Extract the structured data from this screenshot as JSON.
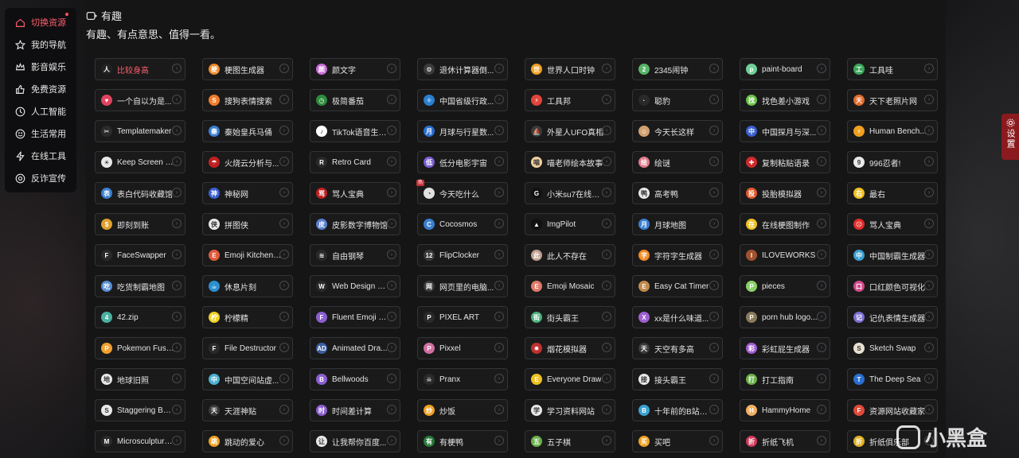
{
  "sidebar": {
    "items": [
      {
        "label": "切换资源",
        "icon": "home-icon",
        "active": true
      },
      {
        "label": "我的导航",
        "icon": "star-icon"
      },
      {
        "label": "影音娱乐",
        "icon": "crown-icon"
      },
      {
        "label": "免费资源",
        "icon": "thumbs-up-icon"
      },
      {
        "label": "人工智能",
        "icon": "clock-icon"
      },
      {
        "label": "生活常用",
        "icon": "smile-icon"
      },
      {
        "label": "在线工具",
        "icon": "bolt-icon"
      },
      {
        "label": "反诈宣传",
        "icon": "target-icon"
      }
    ]
  },
  "section": {
    "title": "有趣",
    "subtitle": "有趣、有点意思、值得一看。"
  },
  "settings": {
    "label": "设置"
  },
  "watermark": {
    "text": "小黑盒"
  },
  "cards": [
    {
      "name": "比较身高",
      "color": "#222",
      "glyph": "人",
      "hot": true
    },
    {
      "name": "梗图生成器",
      "color": "#f08a24",
      "glyph": "梗"
    },
    {
      "name": "颜文字",
      "color": "#c86dd7",
      "glyph": "颜"
    },
    {
      "name": "退休计算器倒...",
      "color": "#3b3b3b",
      "glyph": "⚙"
    },
    {
      "name": "世界人口时钟",
      "color": "#f0a020",
      "glyph": "世"
    },
    {
      "name": "2345闹钟",
      "color": "#58b368",
      "glyph": "2"
    },
    {
      "name": "paint-board",
      "color": "#6fcf97",
      "glyph": "p"
    },
    {
      "name": "工具哇",
      "color": "#3aa65a",
      "glyph": "工"
    },
    {
      "name": "一个自以为是...",
      "color": "#e0445e",
      "glyph": "♥"
    },
    {
      "name": "搜狗表情搜索",
      "color": "#f27b2a",
      "glyph": "S"
    },
    {
      "name": "极简番茄",
      "color": "#2e8b3e",
      "glyph": "◷"
    },
    {
      "name": "中国省级行政...",
      "color": "#2a7fd0",
      "glyph": "⚛"
    },
    {
      "name": "工具邦",
      "color": "#e0443a",
      "glyph": "⚡"
    },
    {
      "name": "聪豹",
      "color": "#2a2a2a",
      "glyph": "·"
    },
    {
      "name": "找色差小游戏",
      "color": "#6cc04a",
      "glyph": "找"
    },
    {
      "name": "天下老照片网",
      "color": "#e06a2a",
      "glyph": "天"
    },
    {
      "name": "Templatemaker",
      "color": "#2b2b2b",
      "glyph": "✂"
    },
    {
      "name": "秦始皇兵马俑",
      "color": "#3a7fd0",
      "glyph": "秦"
    },
    {
      "name": "TikTok语音生成...",
      "color": "#ffffff",
      "glyph": "♪"
    },
    {
      "name": "月球与行星数...",
      "color": "#2a6fd0",
      "glyph": "月"
    },
    {
      "name": "外星人UFO真相",
      "color": "#3a3a3a",
      "glyph": "⛵"
    },
    {
      "name": "今天长这样",
      "color": "#d0a070",
      "glyph": "☺"
    },
    {
      "name": "中国探月与深...",
      "color": "#3a5fd0",
      "glyph": "中"
    },
    {
      "name": "Human Bench...",
      "color": "#f0a020",
      "glyph": "⚡"
    },
    {
      "name": "Keep Screen On",
      "color": "#e8e8e8",
      "glyph": "☀"
    },
    {
      "name": "火烧云分析与...",
      "color": "#c02020",
      "glyph": "☂"
    },
    {
      "name": "Retro Card",
      "color": "#2a2a2a",
      "glyph": "R"
    },
    {
      "name": "低分电影宇宙",
      "color": "#7a5fd0",
      "glyph": "低"
    },
    {
      "name": "喵老师绘本故事",
      "color": "#f0d0a0",
      "glyph": "喵"
    },
    {
      "name": "绘谜",
      "color": "#e07a8a",
      "glyph": "绘"
    },
    {
      "name": "复制粘贴语录",
      "color": "#d02a2a",
      "glyph": "✚"
    },
    {
      "name": "996忍者!",
      "color": "#e8e8e8",
      "glyph": "9"
    },
    {
      "name": "表白代码收藏馆",
      "color": "#3a7fd0",
      "glyph": "表"
    },
    {
      "name": "神秘网",
      "color": "#3a5fd0",
      "glyph": "神"
    },
    {
      "name": "骂人宝典",
      "color": "#c02020",
      "glyph": "骂"
    },
    {
      "name": "今天吃什么",
      "color": "#e0e0e0",
      "glyph": "◔",
      "tag": "热"
    },
    {
      "name": "小米su7在线体...",
      "color": "#111",
      "glyph": "G"
    },
    {
      "name": "高考鸭",
      "color": "#e8e8e8",
      "glyph": "鸭"
    },
    {
      "name": "投胎模拟器",
      "color": "#e05a2a",
      "glyph": "投"
    },
    {
      "name": "最右",
      "color": "#f0c020",
      "glyph": "右"
    },
    {
      "name": "即刻到账",
      "color": "#e0a030",
      "glyph": "$"
    },
    {
      "name": "拼图侠",
      "color": "#e8e8e8",
      "glyph": "侠"
    },
    {
      "name": "皮影数字博物馆",
      "color": "#5a7fd0",
      "glyph": "皮"
    },
    {
      "name": "Cocosmos",
      "color": "#3a7fd0",
      "glyph": "C"
    },
    {
      "name": "ImgPilot",
      "color": "#111",
      "glyph": "▲"
    },
    {
      "name": "月球地图",
      "color": "#3a7fd0",
      "glyph": "月"
    },
    {
      "name": "在线梗图制作",
      "color": "#f0c020",
      "glyph": "在"
    },
    {
      "name": "骂人宝典",
      "color": "#e02a2a",
      "glyph": "☹"
    },
    {
      "name": "FaceSwapper",
      "color": "#2a2a2a",
      "glyph": "F"
    },
    {
      "name": "Emoji Kitchen ...",
      "color": "#e05a3a",
      "glyph": "E"
    },
    {
      "name": "自由钢琴",
      "color": "#2a2a2a",
      "glyph": "≋"
    },
    {
      "name": "FlipClocker",
      "color": "#3a3a3a",
      "glyph": "12"
    },
    {
      "name": "此人不存在",
      "color": "#c0a090",
      "glyph": "此"
    },
    {
      "name": "字符字生成器",
      "color": "#f08a24",
      "glyph": "字"
    },
    {
      "name": "ILOVEWORKS",
      "color": "#a0522d",
      "glyph": "I"
    },
    {
      "name": "中国制霸生成器",
      "color": "#3a9fd0",
      "glyph": "中"
    },
    {
      "name": "吃货制霸地图",
      "color": "#5a8fd0",
      "glyph": "吃"
    },
    {
      "name": "休息片刻",
      "color": "#2a8fd0",
      "glyph": "☕"
    },
    {
      "name": "Web Design M...",
      "color": "#2a2a2a",
      "glyph": "W"
    },
    {
      "name": "网页里的电脑...",
      "color": "#3a3a3a",
      "glyph": "网"
    },
    {
      "name": "Emoji Mosaic",
      "color": "#e07a6a",
      "glyph": "E"
    },
    {
      "name": "Easy Cat Timer",
      "color": "#c08a4a",
      "glyph": "E"
    },
    {
      "name": "pieces",
      "color": "#8ad06a",
      "glyph": "P"
    },
    {
      "name": "口红颜色可视化",
      "color": "#d04a8a",
      "glyph": "口"
    },
    {
      "name": "42.zip",
      "color": "#4ab0a0",
      "glyph": "4"
    },
    {
      "name": "柠檬精",
      "color": "#f0d020",
      "glyph": "柠"
    },
    {
      "name": "Fluent Emoji M...",
      "color": "#8a5fd0",
      "glyph": "F"
    },
    {
      "name": "PIXEL ART",
      "color": "#2a2a2a",
      "glyph": "P"
    },
    {
      "name": "街头霸王",
      "color": "#4ab07a",
      "glyph": "街"
    },
    {
      "name": "xx是什么味道...",
      "color": "#a05fd0",
      "glyph": "X"
    },
    {
      "name": "porn hub logo...",
      "color": "#8a7a5a",
      "glyph": "P"
    },
    {
      "name": "记仇表情生成器",
      "color": "#7a6fd0",
      "glyph": "记"
    },
    {
      "name": "Pokemon Fusion",
      "color": "#f0a030",
      "glyph": "P"
    },
    {
      "name": "File Destructor",
      "color": "#2a2a2a",
      "glyph": "F"
    },
    {
      "name": "Animated Dra...",
      "color": "#3a5fa0",
      "glyph": "AD"
    },
    {
      "name": "Pixxel",
      "color": "#d070a0",
      "glyph": "P"
    },
    {
      "name": "烟花模拟器",
      "color": "#c03030",
      "glyph": "✹"
    },
    {
      "name": "天空有多高",
      "color": "#3a3a3a",
      "glyph": "天"
    },
    {
      "name": "彩虹屁生成器",
      "color": "#a05fd0",
      "glyph": "彩"
    },
    {
      "name": "Sketch Swap",
      "color": "#e8e0d0",
      "glyph": "S"
    },
    {
      "name": "地球旧照",
      "color": "#e8e8e8",
      "glyph": "地"
    },
    {
      "name": "中国空间站虚...",
      "color": "#4ab0d0",
      "glyph": "中"
    },
    {
      "name": "Bellwoods",
      "color": "#8a5fd0",
      "glyph": "B"
    },
    {
      "name": "Pranx",
      "color": "#2a2a2a",
      "glyph": "☠"
    },
    {
      "name": "Everyone Draw",
      "color": "#f0c020",
      "glyph": "E"
    },
    {
      "name": "接头霸王",
      "color": "#e8e8e8",
      "glyph": "接"
    },
    {
      "name": "打工指南",
      "color": "#6ab04a",
      "glyph": "打"
    },
    {
      "name": "The Deep Sea",
      "color": "#2a6fd0",
      "glyph": "T"
    },
    {
      "name": "Staggering Bea...",
      "color": "#e8e8e8",
      "glyph": "S"
    },
    {
      "name": "天涯神贴",
      "color": "#3a3a3a",
      "glyph": "天"
    },
    {
      "name": "时间差计算",
      "color": "#8a5fd0",
      "glyph": "时"
    },
    {
      "name": "炒饭",
      "color": "#f0a020",
      "glyph": "炒"
    },
    {
      "name": "学习资料网站",
      "color": "#e8e8e8",
      "glyph": "学"
    },
    {
      "name": "十年前的B站长...",
      "color": "#3aa0d0",
      "glyph": "B"
    },
    {
      "name": "HammyHome",
      "color": "#f0b060",
      "glyph": "H"
    },
    {
      "name": "资源网站收藏家",
      "color": "#e04a3a",
      "glyph": "F"
    },
    {
      "name": "Microsculpture...",
      "color": "#2a2a2a",
      "glyph": "M"
    },
    {
      "name": "跳动的爱心",
      "color": "#f0a020",
      "glyph": "跳"
    },
    {
      "name": "让我帮你百度...",
      "color": "#e8e8e8",
      "glyph": "让"
    },
    {
      "name": "有梗鸭",
      "color": "#2a7a3a",
      "glyph": "有"
    },
    {
      "name": "五子棋",
      "color": "#6ab04a",
      "glyph": "五"
    },
    {
      "name": "买吧",
      "color": "#f0a020",
      "glyph": "买"
    },
    {
      "name": "折纸飞机",
      "color": "#d03a5a",
      "glyph": "折"
    },
    {
      "name": "折纸俱乐部",
      "color": "#e0b020",
      "glyph": "折"
    }
  ]
}
